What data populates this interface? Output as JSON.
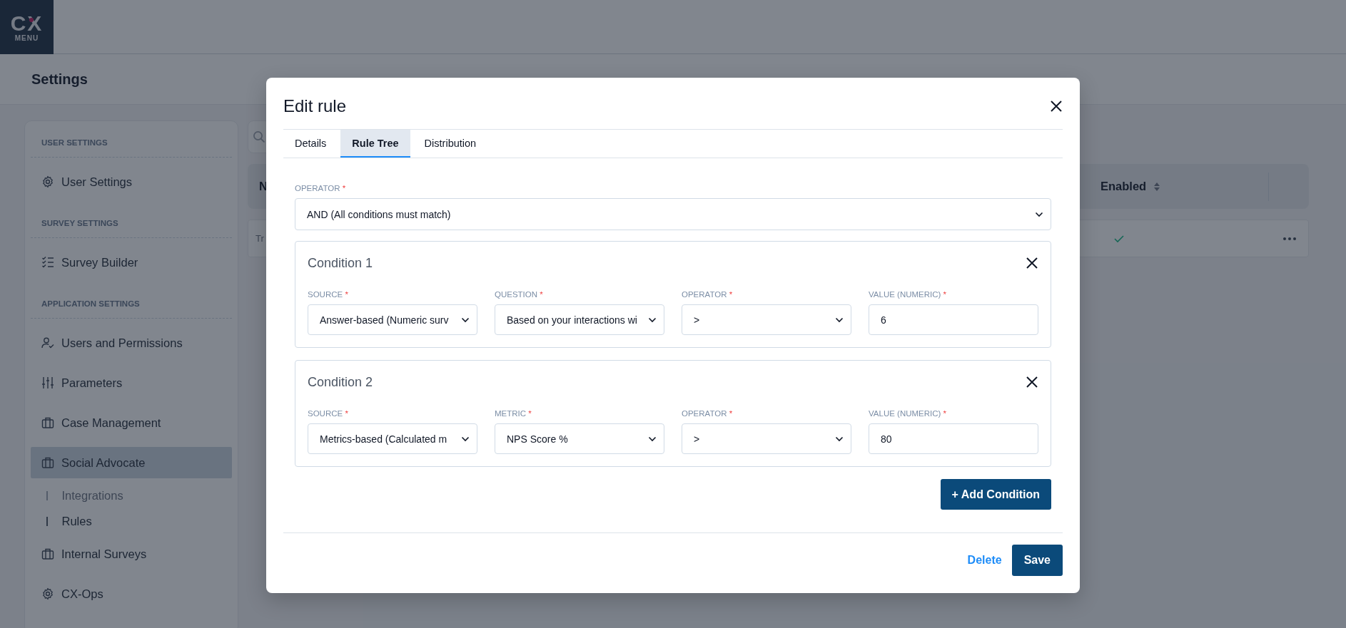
{
  "logo": {
    "mark": "CX",
    "caption": "MENU"
  },
  "page_title": "Settings",
  "sidebar": {
    "sections": [
      {
        "heading": "USER SETTINGS",
        "items": [
          {
            "label": "User Settings",
            "kind": "gear",
            "selected": false
          }
        ]
      },
      {
        "heading": "SURVEY SETTINGS",
        "items": [
          {
            "label": "Survey Builder",
            "kind": "checklist",
            "selected": false
          }
        ]
      },
      {
        "heading": "APPLICATION SETTINGS",
        "items": [
          {
            "label": "Users and Permissions",
            "kind": "user",
            "selected": false
          },
          {
            "label": "Parameters",
            "kind": "sliders",
            "selected": false
          },
          {
            "label": "Case Management",
            "kind": "case",
            "selected": false
          },
          {
            "label": "Social Advocate",
            "kind": "case",
            "selected": true,
            "children": [
              {
                "label": "Integrations",
                "selected": false
              },
              {
                "label": "Rules",
                "selected": true
              }
            ]
          },
          {
            "label": "Internal Surveys",
            "kind": "case",
            "selected": false
          },
          {
            "label": "CX-Ops",
            "kind": "gear",
            "selected": false
          }
        ]
      }
    ]
  },
  "table": {
    "columns": [
      {
        "label": "N",
        "sortable": false
      },
      {
        "label": "Enabled",
        "sortable": true
      }
    ],
    "rows": [
      {
        "cells": [
          "Tr"
        ],
        "enabled": true
      }
    ]
  },
  "modal": {
    "title": "Edit rule",
    "tabs": [
      {
        "label": "Details",
        "selected": false
      },
      {
        "label": "Rule Tree",
        "selected": true
      },
      {
        "label": "Distribution",
        "selected": false
      }
    ],
    "operator": {
      "label": "OPERATOR",
      "required": "*",
      "value": "AND (All conditions must match)"
    },
    "conditions": [
      {
        "title": "Condition 1",
        "fields": [
          {
            "label": "SOURCE",
            "required": "*",
            "kind": "select",
            "value": "Answer-based (Numeric surv"
          },
          {
            "label": "QUESTION",
            "required": "*",
            "kind": "select",
            "value": "Based on your interactions wi"
          },
          {
            "label": "OPERATOR",
            "required": "*",
            "kind": "select",
            "value": ">"
          },
          {
            "label": "VALUE (NUMERIC)",
            "required": "*",
            "kind": "input",
            "value": "6"
          }
        ]
      },
      {
        "title": "Condition 2",
        "fields": [
          {
            "label": "SOURCE",
            "required": "*",
            "kind": "select",
            "value": "Metrics-based (Calculated m"
          },
          {
            "label": "METRIC",
            "required": "*",
            "kind": "select",
            "value": "NPS Score %"
          },
          {
            "label": "OPERATOR",
            "required": "*",
            "kind": "select",
            "value": ">"
          },
          {
            "label": "VALUE (NUMERIC)",
            "required": "*",
            "kind": "input",
            "value": "80"
          }
        ]
      }
    ],
    "add_button": "+ Add Condition",
    "footer": {
      "delete": "Delete",
      "save": "Save"
    }
  }
}
